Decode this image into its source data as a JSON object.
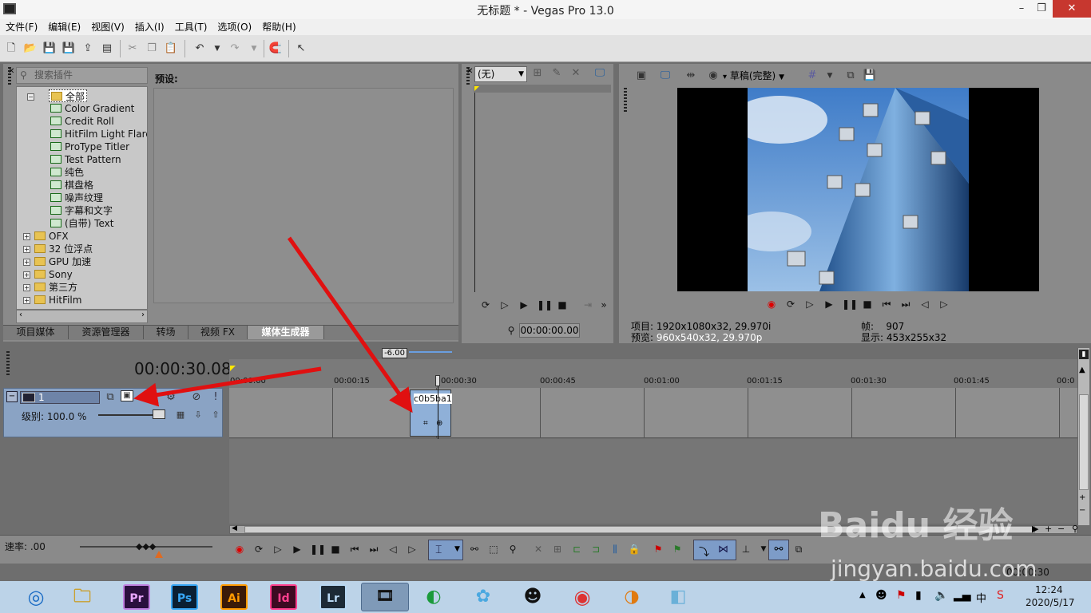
{
  "window": {
    "title": "无标题 * - Vegas Pro 13.0",
    "minimize": "–",
    "maximize": "❐",
    "close": "✕"
  },
  "menu": [
    "文件(F)",
    "编辑(E)",
    "视图(V)",
    "插入(I)",
    "工具(T)",
    "选项(O)",
    "帮助(H)"
  ],
  "plugin_panel": {
    "search_placeholder": "搜索插件",
    "preset_label": "预设:",
    "tree": [
      {
        "label": "全部",
        "type": "folder",
        "expanded": true,
        "selected": true
      },
      {
        "label": "Color Gradient",
        "type": "fx"
      },
      {
        "label": "Credit Roll",
        "type": "fx"
      },
      {
        "label": "HitFilm Light Flares",
        "type": "fx"
      },
      {
        "label": "ProType Titler",
        "type": "fx"
      },
      {
        "label": "Test Pattern",
        "type": "fx"
      },
      {
        "label": "纯色",
        "type": "fx"
      },
      {
        "label": "棋盘格",
        "type": "fx"
      },
      {
        "label": "噪声纹理",
        "type": "fx"
      },
      {
        "label": "字幕和文字",
        "type": "fx"
      },
      {
        "label": "(自带) Text",
        "type": "fx"
      },
      {
        "label": "OFX",
        "type": "folder"
      },
      {
        "label": "32 位浮点",
        "type": "folder"
      },
      {
        "label": "GPU 加速",
        "type": "folder"
      },
      {
        "label": "Sony",
        "type": "folder"
      },
      {
        "label": "第三方",
        "type": "folder"
      },
      {
        "label": "HitFilm",
        "type": "folder"
      }
    ],
    "tabs": [
      "项目媒体",
      "资源管理器",
      "转场",
      "视频 FX",
      "媒体生成器"
    ],
    "active_tab": "媒体生成器"
  },
  "trimmer": {
    "dropdown": "(无)",
    "timecode": "00:00:00.00"
  },
  "preview": {
    "quality": "草稿(完整)",
    "project_label": "项目:",
    "project_value": "1920x1080x32, 29.970i",
    "preview_label": "预览:",
    "preview_value": "960x540x32, 29.970p",
    "frame_label": "帧:",
    "frame_value": "907",
    "display_label": "显示:",
    "display_value": "453x255x32"
  },
  "timeline": {
    "timecode": "00:00:30.08",
    "marker": "-6.00",
    "ruler": [
      "00:00:00",
      "00:00:15",
      "00:00:30",
      "00:00:45",
      "00:01:00",
      "00:01:15",
      "00:01:30",
      "00:01:45",
      "00:0"
    ],
    "track_number": "1",
    "level_label": "级别: 100.0 %",
    "clip_label": "c0b5ba1",
    "rate_label": "速率: .00",
    "status_time": "00:00:30"
  },
  "taskbar": {
    "apps": [
      "Pr",
      "Ps",
      "Ai",
      "Id",
      "Lr"
    ],
    "time": "12:24",
    "date": "2020/5/17",
    "ime": "中"
  },
  "watermark": {
    "brand": "Baidu 经验",
    "url": "jingyan.baidu.com"
  },
  "colors": {
    "pr": "#2a0f3e",
    "ps": "#0a1f33",
    "ai": "#3a1a08",
    "id": "#3d0a22",
    "lr": "#1c2a36",
    "accent_red": "#e01010"
  }
}
